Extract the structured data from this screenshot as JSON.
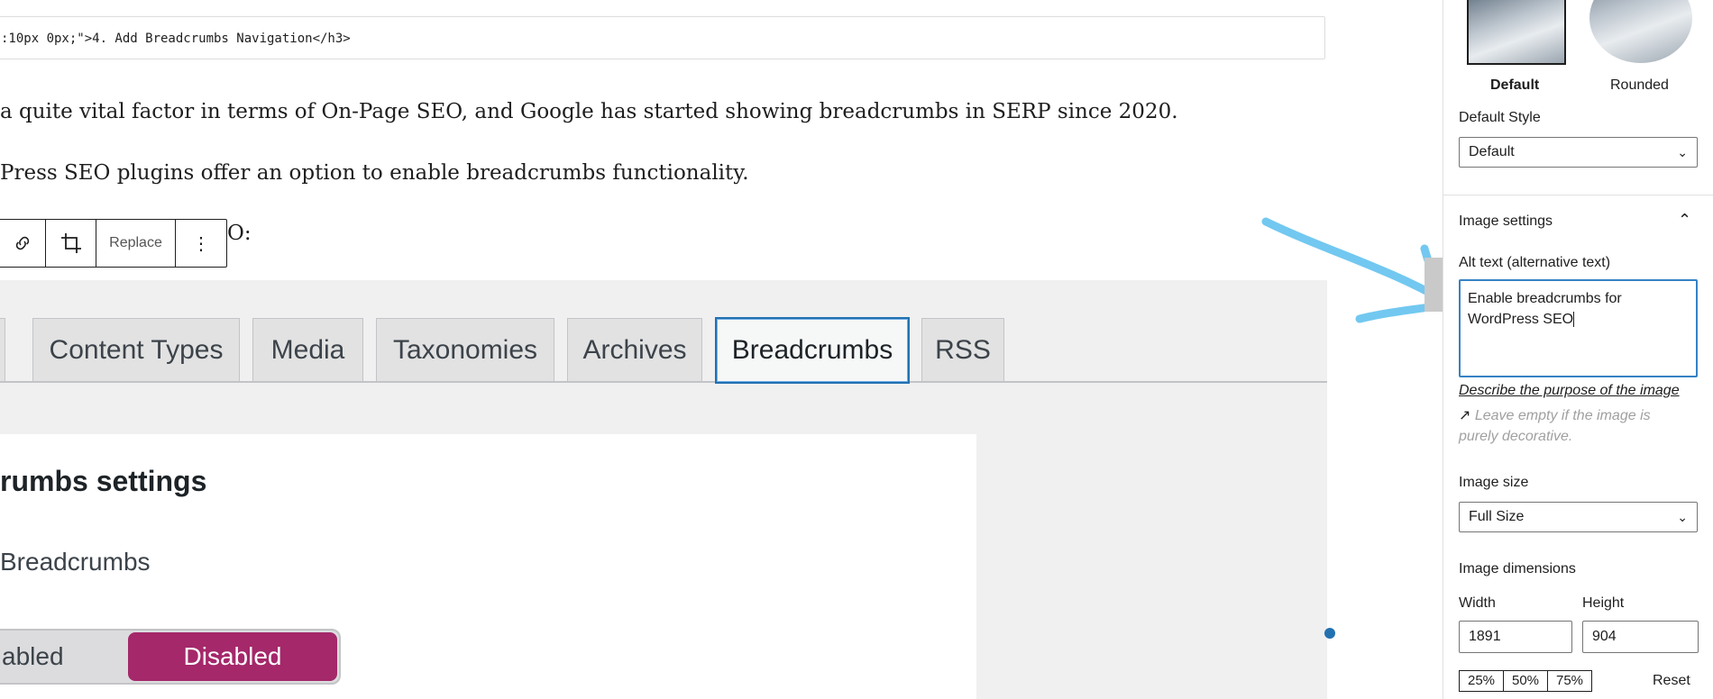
{
  "editor": {
    "code_line": ":10px 0px;\">4. Add Breadcrumbs Navigation</h3>",
    "para1": "a quite vital factor in terms of On-Page SEO, and Google has started showing breadcrumbs in SERP since 2020.",
    "para2": "Press SEO plugins offer an option to enable breadcrumbs functionality.",
    "para3_tail": "O:",
    "toolbar": {
      "link_icon": "link-icon",
      "crop_icon": "crop-icon",
      "replace_label": "Replace",
      "more_label": "⋮"
    }
  },
  "screenshot": {
    "tabs": [
      "Content Types",
      "Media",
      "Taxonomies",
      "Archives",
      "Breadcrumbs",
      "RSS"
    ],
    "active_tab": "Breadcrumbs",
    "panel_title": "rumbs settings",
    "breadcrumbs_label": "Breadcrumbs",
    "toggle_enabled": "abled",
    "toggle_disabled": "Disabled",
    "accent_color": "#a4286a"
  },
  "sidebar": {
    "styles": {
      "default_label": "Default",
      "rounded_label": "Rounded",
      "default_style_label": "Default Style",
      "default_style_value": "Default"
    },
    "image_settings": {
      "title": "Image settings",
      "alt_label": "Alt text (alternative text)",
      "alt_value": "Enable breadcrumbs for WordPress SEO",
      "describe_link": "Describe the purpose of the image",
      "help_line1": "Leave empty if the image is",
      "help_line2": "purely decorative.",
      "size_label": "Image size",
      "size_value": "Full Size",
      "dimensions_label": "Image dimensions",
      "width_label": "Width",
      "height_label": "Height",
      "width_value": "1891",
      "height_value": "904",
      "pct_25": "25%",
      "pct_50": "50%",
      "pct_75": "75%",
      "reset_label": "Reset"
    }
  }
}
